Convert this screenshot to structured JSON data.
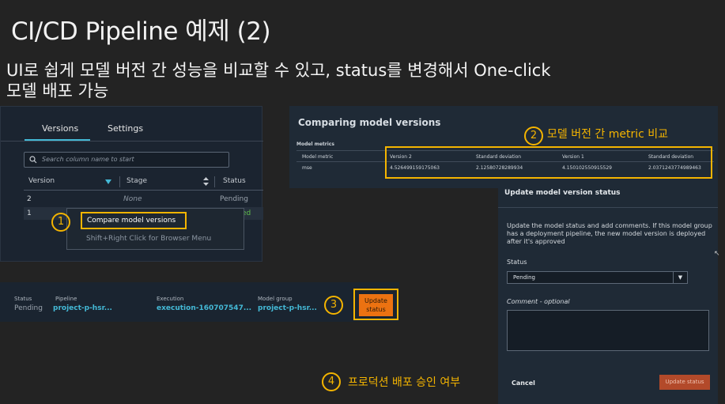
{
  "slide": {
    "title": "CI/CD Pipeline 예제 (2)",
    "subtitle_line1": "UI로 쉽게 모델 버전 간 성능을 비교할 수 있고, status를 변경해서 One-click",
    "subtitle_line2": "모델 배포 가능"
  },
  "versions_panel": {
    "tabs": [
      "Versions",
      "Settings"
    ],
    "search_placeholder": "Search column name to start",
    "columns": [
      "Version",
      "Stage",
      "Status"
    ],
    "rows": [
      {
        "version": "2",
        "stage": "None",
        "status": "Pending"
      },
      {
        "version": "1",
        "stage": "",
        "status": "ed"
      }
    ],
    "context_menu": {
      "item": "Compare model versions",
      "hint": "Shift+Right Click for Browser Menu"
    }
  },
  "markers": {
    "m1": "1",
    "m2": "2",
    "m3": "3",
    "m4": "4"
  },
  "compare_panel": {
    "title": "Comparing model versions",
    "section": "Model metrics",
    "headers": [
      "Model metric",
      "Version 2",
      "Standard deviation",
      "Version 1",
      "Standard deviation"
    ],
    "row": [
      "mse",
      "4.526499159175063",
      "2.12580728289934",
      "4.150102550915529",
      "2.0371243774989463"
    ]
  },
  "annotations": {
    "a2": "모델 버전 간 metric 비교",
    "a4": "프로덕션 배포 승인 여부"
  },
  "update_panel": {
    "title": "Update model version status",
    "description": "Update the model status and add comments. If this model group has a deployment pipeline, the new model version is deployed after it's approved",
    "status_label": "Status",
    "status_value": "Pending",
    "comment_label": "Comment - optional",
    "cancel": "Cancel",
    "update": "Update status"
  },
  "pipeline_row": {
    "status_label": "Status",
    "status_value": "Pending",
    "pipeline_label": "Pipeline",
    "pipeline_value": "project-p-hsr...",
    "execution_label": "Execution",
    "execution_value": "execution-160707547...",
    "group_label": "Model group",
    "group_value": "project-p-hsr...",
    "button_line1": "Update",
    "button_line2": "status"
  },
  "icons": {
    "search": "search-icon",
    "sort": "sort-icon",
    "caret": "chevron-down-icon",
    "cursor": "mouse-cursor-icon"
  },
  "colors": {
    "accent": "#f4b400",
    "link": "#44b9d6",
    "primary_button": "#ec7211"
  }
}
